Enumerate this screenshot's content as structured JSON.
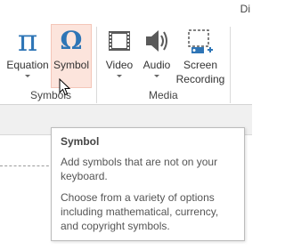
{
  "tab_fragment": "Di",
  "groups": {
    "symbols": {
      "label": "Symbols",
      "equation_label": "Equation",
      "equation_glyph": "π",
      "symbol_label": "Symbol",
      "symbol_glyph": "Ω"
    },
    "media": {
      "label": "Media",
      "video_label": "Video",
      "audio_label": "Audio",
      "screen_recording_line1": "Screen",
      "screen_recording_line2": "Recording"
    }
  },
  "tooltip": {
    "title": "Symbol",
    "paragraph1": "Add symbols that are not on your keyboard.",
    "paragraph2": "Choose from a variety of options including mathematical, currency, and copyright symbols."
  },
  "colors": {
    "icon_blue": "#2e75b6",
    "hover_fill": "#fce4dc",
    "hover_border": "#f4c6b8"
  }
}
